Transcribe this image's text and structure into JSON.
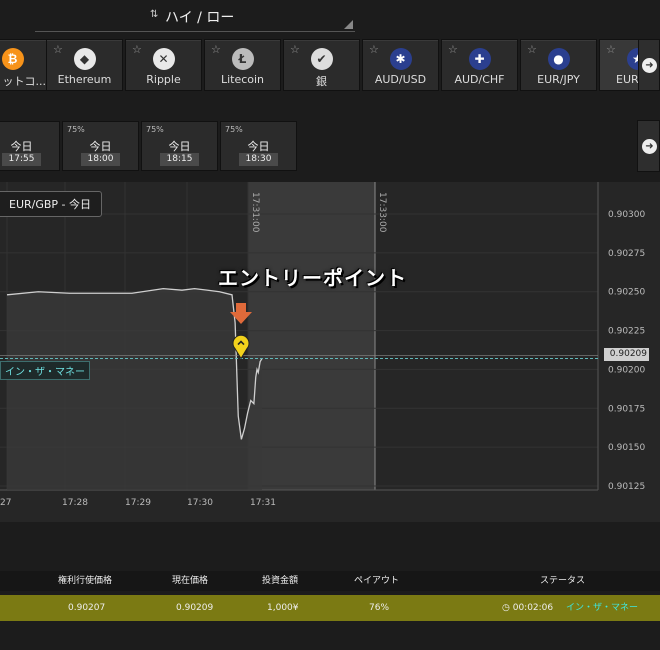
{
  "header": {
    "mode_arrows": "⇅",
    "mode_label": "ハイ / ロー"
  },
  "assets": [
    {
      "name": "ットコ...",
      "icon": "bitcoin-icon",
      "symbol": "₿",
      "color": "#f7931a"
    },
    {
      "name": "Ethereum",
      "icon": "ethereum-icon",
      "symbol": "◆",
      "color": "#e8e8e8"
    },
    {
      "name": "Ripple",
      "icon": "ripple-icon",
      "symbol": "✕",
      "color": "#e8e8e8"
    },
    {
      "name": "Litecoin",
      "icon": "litecoin-icon",
      "symbol": "Ł",
      "color": "#bbbbbb"
    },
    {
      "name": "銀",
      "icon": "silver-icon",
      "symbol": "✔",
      "color": "#dddddd"
    },
    {
      "name": "AUD/USD",
      "icon": "aud-usd-flag-icon",
      "symbol": "✱",
      "color": "#2b3f8f"
    },
    {
      "name": "AUD/CHF",
      "icon": "aud-chf-flag-icon",
      "symbol": "✚",
      "color": "#2b3f8f"
    },
    {
      "name": "EUR/JPY",
      "icon": "eur-jpy-flag-icon",
      "symbol": "●",
      "color": "#2b3f8f"
    },
    {
      "name": "EUR",
      "icon": "eur-gbp-flag-icon",
      "symbol": "★",
      "color": "#2b3f8f"
    }
  ],
  "star_glyph": "☆",
  "nav_glyph": "➜",
  "expiries": [
    {
      "pct": "%",
      "day": "今日",
      "time": "17:55"
    },
    {
      "pct": "75%",
      "day": "今日",
      "time": "18:00"
    },
    {
      "pct": "75%",
      "day": "今日",
      "time": "18:15"
    },
    {
      "pct": "75%",
      "day": "今日",
      "time": "18:30"
    }
  ],
  "chart": {
    "pair_label": "EUR/GBP - 今日",
    "entry_label": "エントリーポイント",
    "strike_label": "イン・ザ・マネー",
    "current_price": "0.90209",
    "expiry_marker_1": "17:31:00",
    "expiry_marker_2": "17:33:00"
  },
  "chart_data": {
    "type": "line",
    "yticks": [
      "0.90300",
      "0.90275",
      "0.90250",
      "0.90225",
      "0.90200",
      "0.90175",
      "0.90150",
      "0.90125"
    ],
    "xticks": [
      "27",
      "17:28",
      "17:29",
      "17:30",
      "17:31"
    ],
    "ylim": [
      0.90125,
      0.903
    ],
    "strike": 0.90207,
    "series": [
      {
        "values": [
          [
            17.27,
            0.90248
          ],
          [
            17.275,
            0.9025
          ],
          [
            17.28,
            0.90249
          ],
          [
            17.285,
            0.90249
          ],
          [
            17.29,
            0.90249
          ],
          [
            17.295,
            0.90252
          ],
          [
            17.298,
            0.90251
          ],
          [
            17.3,
            0.90252
          ],
          [
            17.302,
            0.90251
          ],
          [
            17.304,
            0.9025
          ],
          [
            17.306,
            0.90248
          ],
          [
            17.3065,
            0.9023
          ],
          [
            17.307,
            0.9017
          ],
          [
            17.3075,
            0.90155
          ],
          [
            17.308,
            0.90162
          ],
          [
            17.3085,
            0.90172
          ],
          [
            17.309,
            0.9018
          ],
          [
            17.3095,
            0.90178
          ],
          [
            17.3098,
            0.90195
          ],
          [
            17.31,
            0.902
          ],
          [
            17.3102,
            0.90198
          ],
          [
            17.3105,
            0.90205
          ],
          [
            17.3108,
            0.90207
          ]
        ]
      }
    ]
  },
  "table": {
    "headers": [
      "権利行使価格",
      "現在価格",
      "投資金額",
      "ペイアウト",
      "ステータス"
    ],
    "row": [
      "0.90207",
      "0.90209",
      "1,000¥",
      "76%"
    ],
    "status_time": "◷ 00:02:06",
    "status_text": "イン・ザ・マネー"
  }
}
